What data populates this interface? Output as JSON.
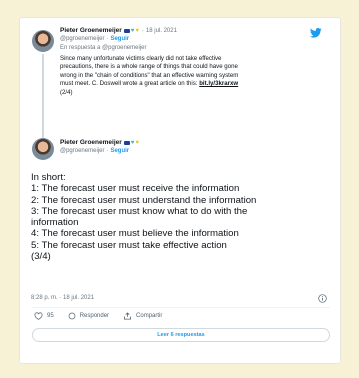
{
  "quoted_tweet": {
    "author_name": "Pieter Groenemeijer",
    "dot": "·",
    "date": "18 jul. 2021",
    "handle": "@pgroenemeijer",
    "dot2": "·",
    "follow_label": "Seguir",
    "reply_to": "En respuesta a @pgroenemeijer",
    "lines": [
      "Since many unfortunate victims clearly did not take effective",
      "precautions, there is a whole range of things that could have gone",
      "wrong in the \"chain of conditions\" that an effective warning system",
      "must meet. C. Doswell wrote a great article on this:"
    ],
    "link": "bit.ly/3krarxw",
    "counter": "(2/4)"
  },
  "tweet": {
    "author_name": "Pieter Groenemeijer",
    "handle": "@pgroenemeijer",
    "dot": "·",
    "follow_label": "Seguir",
    "lines": [
      "In short:",
      "1: The forecast user must receive the information",
      "2: The forecast user must understand the information",
      "3: The forecast user must know what to do with the",
      "information",
      "4: The forecast user must believe the information",
      "5: The forecast user must take effective action",
      "(3/4)"
    ],
    "timestamp": "8:28 p. m. · 18 jul. 2021"
  },
  "actions": {
    "likes_count": "95",
    "reply_label": "Responder",
    "share_label": "Compartir",
    "more_replies_label": "Leer 6 respuestas"
  },
  "colors": {
    "accent": "#1d9bf0",
    "background": "#f7f2d5",
    "text": "#0f1419",
    "muted": "#697680"
  },
  "icons": [
    "twitter-bird-icon",
    "info-icon",
    "heart-icon",
    "reply-icon",
    "share-icon",
    "verified-flag-icon"
  ]
}
